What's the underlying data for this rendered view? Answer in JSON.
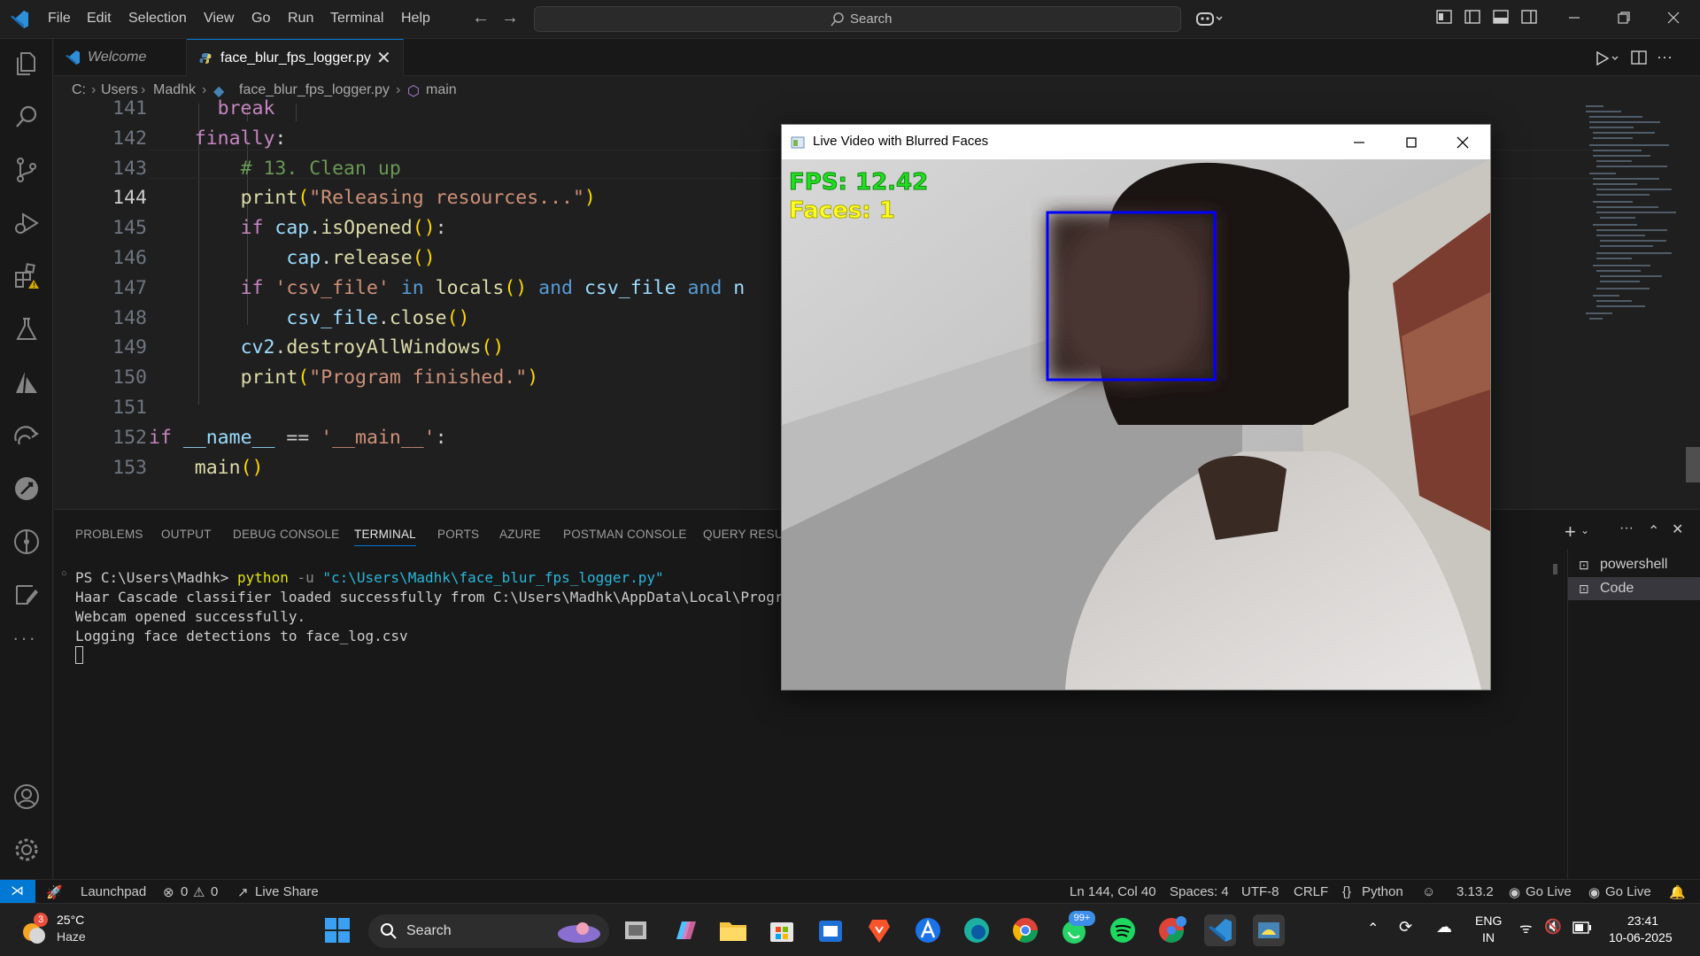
{
  "menu": [
    "File",
    "Edit",
    "Selection",
    "View",
    "Go",
    "Run",
    "Terminal",
    "Help"
  ],
  "search": {
    "label": "Search"
  },
  "tabs": [
    {
      "label": "Welcome",
      "active": false
    },
    {
      "label": "face_blur_fps_logger.py",
      "active": true
    }
  ],
  "breadcrumb": [
    "C:",
    "Users",
    "Madhk",
    "face_blur_fps_logger.py",
    "main"
  ],
  "editor": {
    "current_line": "144",
    "lines": [
      {
        "n": "141",
        "parts": [
          [
            "      ",
            "op"
          ],
          [
            "break",
            "kw"
          ]
        ]
      },
      {
        "n": "142",
        "parts": [
          [
            "    ",
            "op"
          ],
          [
            "finally",
            "kw"
          ],
          [
            ":",
            "op"
          ]
        ]
      },
      {
        "n": "143",
        "parts": [
          [
            "        ",
            "op"
          ],
          [
            "# 13. Clean up",
            "cm"
          ]
        ]
      },
      {
        "n": "144",
        "parts": [
          [
            "        ",
            "op"
          ],
          [
            "print",
            "fn"
          ],
          [
            "(",
            "br1"
          ],
          [
            "\"Releasing resources...\"",
            "str"
          ],
          [
            ")",
            "br1"
          ]
        ]
      },
      {
        "n": "145",
        "parts": [
          [
            "        ",
            "op"
          ],
          [
            "if",
            "kw"
          ],
          [
            " ",
            "op"
          ],
          [
            "cap",
            "var"
          ],
          [
            ".",
            "op"
          ],
          [
            "isOpened",
            "fn"
          ],
          [
            "()",
            "br1"
          ],
          [
            ":",
            "op"
          ]
        ]
      },
      {
        "n": "146",
        "parts": [
          [
            "            ",
            "op"
          ],
          [
            "cap",
            "var"
          ],
          [
            ".",
            "op"
          ],
          [
            "release",
            "fn"
          ],
          [
            "()",
            "br1"
          ]
        ]
      },
      {
        "n": "147",
        "parts": [
          [
            "        ",
            "op"
          ],
          [
            "if",
            "kw"
          ],
          [
            " ",
            "op"
          ],
          [
            "'csv_file'",
            "str"
          ],
          [
            " ",
            "op"
          ],
          [
            "in",
            "bl"
          ],
          [
            " ",
            "op"
          ],
          [
            "locals",
            "fn"
          ],
          [
            "()",
            "br1"
          ],
          [
            " ",
            "op"
          ],
          [
            "and",
            "bl"
          ],
          [
            " ",
            "op"
          ],
          [
            "csv_file",
            "var"
          ],
          [
            " ",
            "op"
          ],
          [
            "and",
            "bl"
          ],
          [
            " n",
            "var"
          ]
        ]
      },
      {
        "n": "148",
        "parts": [
          [
            "            ",
            "op"
          ],
          [
            "csv_file",
            "var"
          ],
          [
            ".",
            "op"
          ],
          [
            "close",
            "fn"
          ],
          [
            "()",
            "br1"
          ]
        ]
      },
      {
        "n": "149",
        "parts": [
          [
            "        ",
            "op"
          ],
          [
            "cv2",
            "var"
          ],
          [
            ".",
            "op"
          ],
          [
            "destroyAllWindows",
            "fn"
          ],
          [
            "()",
            "br1"
          ]
        ]
      },
      {
        "n": "150",
        "parts": [
          [
            "        ",
            "op"
          ],
          [
            "print",
            "fn"
          ],
          [
            "(",
            "br1"
          ],
          [
            "\"Program finished.\"",
            "str"
          ],
          [
            ")",
            "br1"
          ]
        ]
      },
      {
        "n": "151",
        "parts": []
      },
      {
        "n": "152",
        "parts": [
          [
            "if",
            "kw"
          ],
          [
            " ",
            "op"
          ],
          [
            "__name__",
            "var"
          ],
          [
            " == ",
            "op"
          ],
          [
            "'__main__'",
            "str"
          ],
          [
            ":",
            "op"
          ]
        ]
      },
      {
        "n": "153",
        "parts": [
          [
            "    ",
            "op"
          ],
          [
            "main",
            "fn"
          ],
          [
            "()",
            "br1"
          ]
        ]
      }
    ]
  },
  "panel": {
    "tabs": [
      "PROBLEMS",
      "OUTPUT",
      "DEBUG CONSOLE",
      "TERMINAL",
      "PORTS",
      "AZURE",
      "POSTMAN CONSOLE",
      "QUERY RESULT"
    ],
    "active_tab": "TERMINAL",
    "terminal": {
      "prompt": "PS C:\\Users\\Madhk> ",
      "cmd": "python",
      "flag": " -u ",
      "arg": "\"c:\\Users\\Madhk\\face_blur_fps_logger.py\"",
      "lines": [
        "Haar Cascade classifier loaded successfully from C:\\Users\\Madhk\\AppData\\Local\\Programs\\Py",
        "Webcam opened successfully.",
        "Logging face detections to face_log.csv"
      ]
    },
    "terminals": [
      "powershell",
      "Code"
    ]
  },
  "status": {
    "launchpad": "Launchpad",
    "errors": "0",
    "warnings": "0",
    "liveshare": "Live Share",
    "position": "Ln 144, Col 40",
    "spaces": "Spaces: 4",
    "encoding": "UTF-8",
    "eol": "CRLF",
    "language": "Python",
    "version": "3.13.2",
    "golive1": "Go Live",
    "golive2": "Go Live"
  },
  "cv_window": {
    "title": "Live Video with Blurred Faces",
    "fps_text": "FPS: 12.42",
    "faces_text": "Faces: 1"
  },
  "taskbar": {
    "weather_temp": "25°C",
    "weather_desc": "Haze",
    "weather_badge": "3",
    "search": "Search",
    "whatsapp_badge": "99+",
    "lang1": "ENG",
    "lang2": "IN",
    "time": "23:41",
    "date": "10-06-2025"
  },
  "colors": {
    "accent": "#0078d4",
    "face_box": "#0000ff",
    "fps": "#22dd22",
    "faces": "#ffff22"
  }
}
